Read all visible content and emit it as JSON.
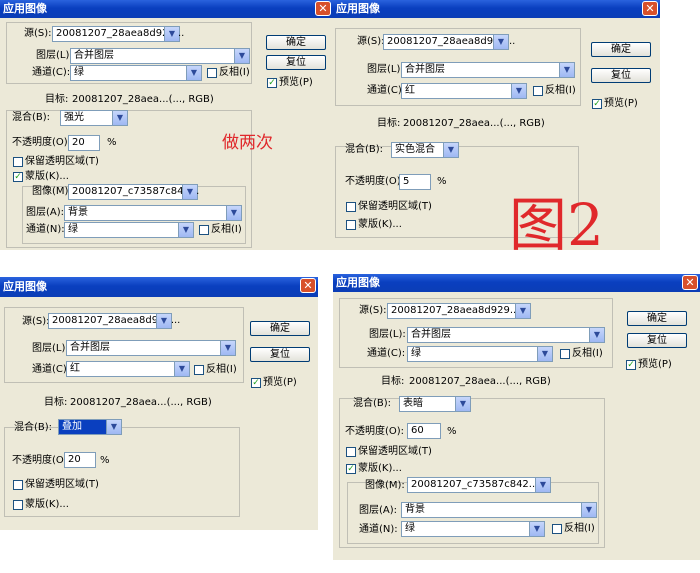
{
  "dialogs": [
    {
      "title": "应用图像",
      "source_label": "源(S):",
      "source": "20081207_28aea8d929...",
      "layer_label": "图层(L):",
      "layer": "合并图层",
      "channel_label": "通道(C):",
      "channel": "绿",
      "invert_label": "反相(I)",
      "target_label": "目标:",
      "target": "20081207_28aea...(..., RGB)",
      "blend_label": "混合(B):",
      "blend": "强光",
      "opacity_label": "不透明度(O):",
      "opacity": "20",
      "pct": "%",
      "preserve_label": "保留透明区域(T)",
      "mask_label": "蒙版(K)...",
      "mask_image_label": "图像(M):",
      "mask_image": "20081207_c73587c842...",
      "mask_layer_label": "图层(A):",
      "mask_layer": "背景",
      "mask_channel_label": "通道(N):",
      "mask_channel": "绿",
      "mask_invert_label": "反相(I)",
      "ok": "确定",
      "reset": "复位",
      "preview": "预览(P)",
      "annotation": "做两次"
    },
    {
      "title": "应用图像",
      "source_label": "源(S):",
      "source": "20081207_28aea8d929...",
      "layer_label": "图层(L):",
      "layer": "合并图层",
      "channel_label": "通道(C):",
      "channel": "红",
      "invert_label": "反相(I)",
      "target_label": "目标:",
      "target": "20081207_28aea...(..., RGB)",
      "blend_label": "混合(B):",
      "blend": "实色混合",
      "opacity_label": "不透明度(O):",
      "opacity": "5",
      "pct": "%",
      "preserve_label": "保留透明区域(T)",
      "mask_label": "蒙版(K)...",
      "ok": "确定",
      "reset": "复位",
      "preview": "预览(P)",
      "annotation": "图2"
    },
    {
      "title": "应用图像",
      "source_label": "源(S):",
      "source": "20081207_28aea8d929...",
      "layer_label": "图层(L):",
      "layer": "合并图层",
      "channel_label": "通道(C):",
      "channel": "红",
      "invert_label": "反相(I)",
      "target_label": "目标:",
      "target": "20081207_28aea...(..., RGB)",
      "blend_label": "混合(B):",
      "blend": "叠加",
      "opacity_label": "不透明度(O):",
      "opacity": "20",
      "pct": "%",
      "preserve_label": "保留透明区域(T)",
      "mask_label": "蒙版(K)...",
      "ok": "确定",
      "reset": "复位",
      "preview": "预览(P)"
    },
    {
      "title": "应用图像",
      "source_label": "源(S):",
      "source": "20081207_28aea8d929...",
      "layer_label": "图层(L):",
      "layer": "合并图层",
      "channel_label": "通道(C):",
      "channel": "绿",
      "invert_label": "反相(I)",
      "target_label": "目标:",
      "target": "20081207_28aea...(..., RGB)",
      "blend_label": "混合(B):",
      "blend": "表暗",
      "opacity_label": "不透明度(O):",
      "opacity": "60",
      "pct": "%",
      "preserve_label": "保留透明区域(T)",
      "mask_label": "蒙版(K)...",
      "mask_image_label": "图像(M):",
      "mask_image": "20081207_c73587c842...",
      "mask_layer_label": "图层(A):",
      "mask_layer": "背景",
      "mask_channel_label": "通道(N):",
      "mask_channel": "绿",
      "mask_invert_label": "反相(I)",
      "ok": "确定",
      "reset": "复位",
      "preview": "预览(P)"
    }
  ],
  "colors": {
    "titlebar": "#0a3fbf",
    "dialog_bg": "#ece9d8",
    "annotation": "#e0282b",
    "highlight": "#0a3fbf"
  }
}
